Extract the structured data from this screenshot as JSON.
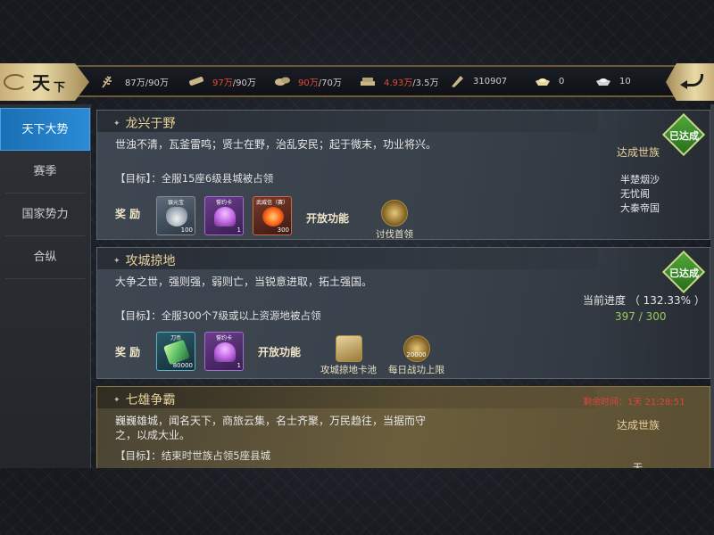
{
  "header": {
    "title_main": "天",
    "title_sub": "下",
    "resources": [
      {
        "icon": "grain-icon",
        "value": "87万/90万",
        "highlight": ""
      },
      {
        "icon": "wood-icon",
        "value_red": "97万",
        "value_rest": "/90万"
      },
      {
        "icon": "stone-icon",
        "value_red": "90万",
        "value_rest": "/70万"
      },
      {
        "icon": "iron-icon",
        "value_red": "4.93万",
        "value_rest": "/3.5万"
      },
      {
        "icon": "token-icon",
        "value": "310907"
      },
      {
        "icon": "gold-ingot-icon",
        "value": "0"
      },
      {
        "icon": "silver-ingot-icon",
        "value": "10"
      }
    ]
  },
  "sidebar": {
    "items": [
      {
        "label": "天下大势",
        "active": true
      },
      {
        "label": "赛季",
        "active": false
      },
      {
        "label": "国家势力",
        "active": false
      },
      {
        "label": "合纵",
        "active": false
      }
    ]
  },
  "cards": [
    {
      "title": "龙兴于野",
      "desc": "世浊不清，瓦釜雷鸣；贤士在野，治乱安民；起于微末，功业将兴。",
      "goal": "【目标】：全服15座6级县城被占领",
      "reward_label": "奖 励",
      "rewards": [
        {
          "type": "silver",
          "name": "银元宝",
          "count": "100"
        },
        {
          "type": "purple",
          "name": "誓约卡",
          "count": "1"
        },
        {
          "type": "orange",
          "name": "武威信（赛）",
          "count": "300"
        }
      ],
      "unlock_label": "开放功能",
      "features": [
        {
          "name": "讨伐首领",
          "badge": ""
        }
      ],
      "badge": "已达成",
      "status": "达成世族",
      "clans": [
        "半楚烟沙",
        "无忧阁",
        "大秦帝国"
      ]
    },
    {
      "title": "攻城掠地",
      "desc": "大争之世，强则强，弱则亡，当锐意进取，拓土强国。",
      "goal": "【目标】：全服300个7级或以上资源地被占领",
      "reward_label": "奖 励",
      "rewards": [
        {
          "type": "teal",
          "name": "刀币",
          "count": "80000"
        },
        {
          "type": "purple",
          "name": "誓约卡",
          "count": "1"
        }
      ],
      "unlock_label": "开放功能",
      "features": [
        {
          "name": "攻城掠地卡池",
          "badge": ""
        },
        {
          "name": "每日战功上限",
          "badge": "20000"
        }
      ],
      "badge": "已达成",
      "progress_label": "当前进度 （ 132.33% ）",
      "progress_nums": "397 / 300",
      "progress_ratio": 1.3233
    },
    {
      "title": "七雄争霸",
      "desc_line1": "巍巍雄城，闻名天下，商旅云集，名士齐聚，万民趋往，当据而守",
      "desc_line2": "之，以成大业。",
      "goal": "【目标】：结束时世族占领5座县城",
      "countdown": "剩余时间：1天 21:28:51",
      "status": "达成世族",
      "clan_partial": "无"
    }
  ]
}
